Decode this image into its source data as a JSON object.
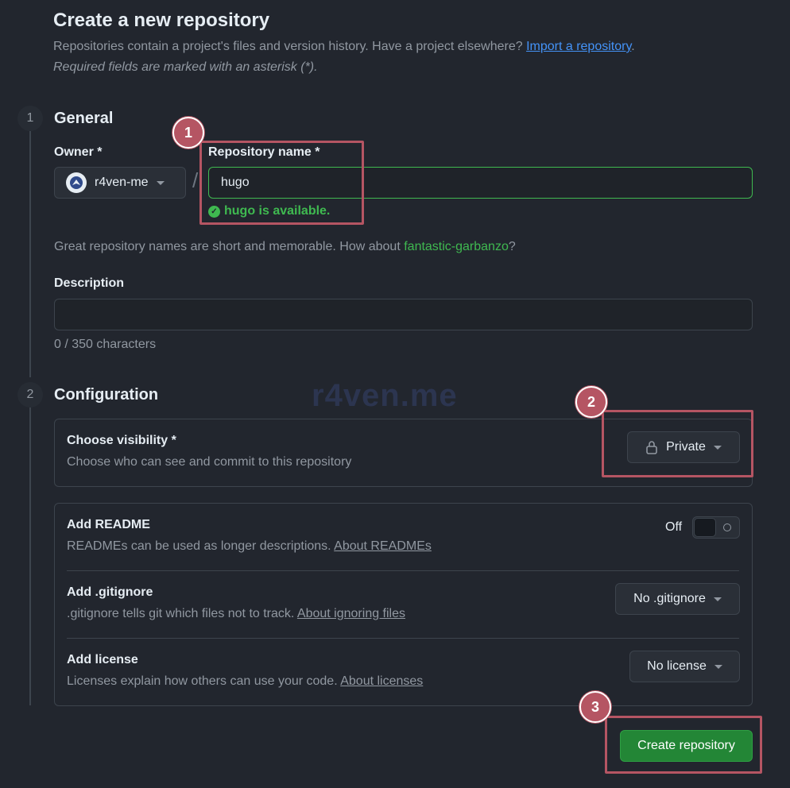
{
  "header": {
    "title": "Create a new repository",
    "subtitle_text": "Repositories contain a project's files and version history. Have a project elsewhere?",
    "import_link": "Import a repository",
    "subtitle_end": ".",
    "required_note": "Required fields are marked with an asterisk (*)."
  },
  "steps": {
    "general": {
      "num": "1",
      "title": "General"
    },
    "configuration": {
      "num": "2",
      "title": "Configuration"
    }
  },
  "owner": {
    "label": "Owner *",
    "value": "r4ven-me"
  },
  "separator": "/",
  "repo_name": {
    "label": "Repository name *",
    "value": "hugo",
    "availability": "hugo is available."
  },
  "name_hint": {
    "text": "Great repository names are short and memorable. How about",
    "suggestion": "fantastic-garbanzo",
    "end": "?"
  },
  "description": {
    "label": "Description",
    "value": "",
    "counter": "0 / 350 characters"
  },
  "visibility": {
    "title": "Choose visibility *",
    "desc": "Choose who can see and commit to this repository",
    "value": "Private"
  },
  "readme": {
    "title": "Add README",
    "desc": "READMEs can be used as longer descriptions.",
    "link": "About READMEs",
    "toggle_label": "Off"
  },
  "gitignore": {
    "title": "Add .gitignore",
    "desc": ".gitignore tells git which files not to track.",
    "link": "About ignoring files",
    "value": "No .gitignore"
  },
  "license": {
    "title": "Add license",
    "desc": "Licenses explain how others can use your code.",
    "link": "About licenses",
    "value": "No license"
  },
  "create_button": "Create repository",
  "watermark": "r4ven.me",
  "markers": [
    "1",
    "2",
    "3"
  ],
  "colors": {
    "background": "#22262e",
    "success": "#3fb950",
    "link": "#4493f8",
    "primary_button": "#238636",
    "annotation": "#b55563"
  }
}
